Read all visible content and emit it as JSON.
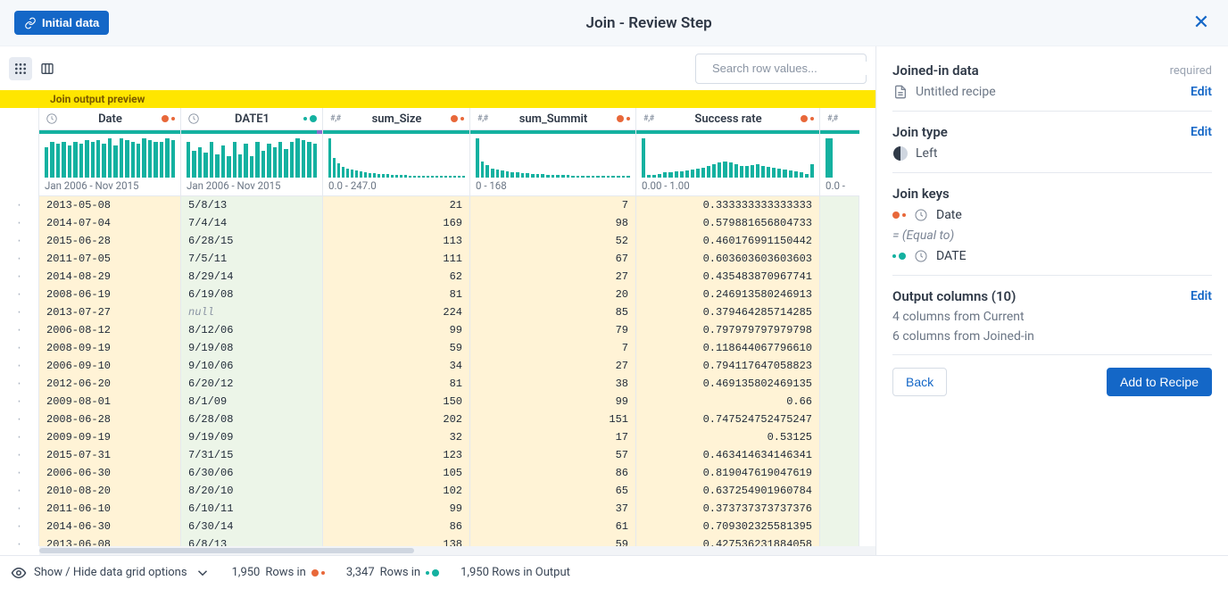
{
  "header": {
    "initial_data_label": "Initial data",
    "title": "Join - Review Step"
  },
  "toolbar": {
    "search_placeholder": "Search row values..."
  },
  "preview_band": "Join output preview",
  "columns": [
    {
      "name": "Date",
      "type": "date",
      "source": "left",
      "range": "Jan 2006 - Nov 2015",
      "chart": [
        34,
        40,
        38,
        40,
        36,
        40,
        38,
        42,
        40,
        42,
        38,
        44,
        36,
        44,
        42,
        40,
        38,
        44,
        42,
        40,
        40,
        44,
        42
      ]
    },
    {
      "name": "DATE1",
      "type": "date",
      "source": "right",
      "range": "Jan 2006 - Nov 2015",
      "chart": [
        40,
        30,
        34,
        28,
        40,
        26,
        36,
        24,
        40,
        26,
        38,
        24,
        40,
        30,
        38,
        34,
        40,
        32,
        40,
        44,
        42,
        40,
        38
      ]
    },
    {
      "name": "sum_Size",
      "type": "num",
      "source": "left",
      "range": "0.0 - 247.0",
      "chart": [
        44,
        22,
        16,
        12,
        10,
        9,
        8,
        7,
        6,
        5,
        5,
        4,
        4,
        4,
        3,
        3,
        3,
        3,
        2,
        2,
        2,
        2,
        2,
        2,
        2,
        2,
        2,
        2,
        2,
        2,
        2
      ]
    },
    {
      "name": "sum_Summit",
      "type": "num",
      "source": "left",
      "range": "0 - 168",
      "chart": [
        44,
        18,
        14,
        10,
        9,
        8,
        7,
        6,
        6,
        5,
        5,
        4,
        4,
        4,
        3,
        3,
        3,
        3,
        3,
        2,
        2,
        2,
        2,
        2,
        2,
        2,
        2,
        2,
        2,
        2,
        2
      ]
    },
    {
      "name": "Success rate",
      "type": "num",
      "source": "left",
      "range": "0.00 - 1.00",
      "chart": [
        40,
        3,
        3,
        4,
        5,
        5,
        6,
        6,
        7,
        8,
        9,
        10,
        12,
        14,
        15,
        16,
        15,
        14,
        12,
        12,
        13,
        14,
        12,
        11,
        10,
        9,
        8,
        7,
        6,
        5,
        4,
        14
      ]
    }
  ],
  "peek_col": {
    "type": "num",
    "range": "0.0 -"
  },
  "rows": [
    {
      "date": "2013-05-08",
      "date1": "5/8/13",
      "size": "21",
      "summit": "7",
      "rate": "0.333333333333333"
    },
    {
      "date": "2014-07-04",
      "date1": "7/4/14",
      "size": "169",
      "summit": "98",
      "rate": "0.579881656804733"
    },
    {
      "date": "2015-06-28",
      "date1": "6/28/15",
      "size": "113",
      "summit": "52",
      "rate": "0.460176991150442"
    },
    {
      "date": "2011-07-05",
      "date1": "7/5/11",
      "size": "111",
      "summit": "67",
      "rate": "0.603603603603603"
    },
    {
      "date": "2014-08-29",
      "date1": "8/29/14",
      "size": "62",
      "summit": "27",
      "rate": "0.435483870967741"
    },
    {
      "date": "2008-06-19",
      "date1": "6/19/08",
      "size": "81",
      "summit": "20",
      "rate": "0.246913580246913"
    },
    {
      "date": "2013-07-27",
      "date1_null": true,
      "size": "224",
      "summit": "85",
      "rate": "0.379464285714285"
    },
    {
      "date": "2006-08-12",
      "date1": "8/12/06",
      "size": "99",
      "summit": "79",
      "rate": "0.797979797979798"
    },
    {
      "date": "2008-09-19",
      "date1": "9/19/08",
      "size": "59",
      "summit": "7",
      "rate": "0.118644067796610"
    },
    {
      "date": "2006-09-10",
      "date1": "9/10/06",
      "size": "34",
      "summit": "27",
      "rate": "0.794117647058823"
    },
    {
      "date": "2012-06-20",
      "date1": "6/20/12",
      "size": "81",
      "summit": "38",
      "rate": "0.469135802469135"
    },
    {
      "date": "2009-08-01",
      "date1": "8/1/09",
      "size": "150",
      "summit": "99",
      "rate": "0.66"
    },
    {
      "date": "2008-06-28",
      "date1": "6/28/08",
      "size": "202",
      "summit": "151",
      "rate": "0.747524752475247"
    },
    {
      "date": "2009-09-19",
      "date1": "9/19/09",
      "size": "32",
      "summit": "17",
      "rate": "0.53125"
    },
    {
      "date": "2015-07-31",
      "date1": "7/31/15",
      "size": "123",
      "summit": "57",
      "rate": "0.463414634146341"
    },
    {
      "date": "2006-06-30",
      "date1": "6/30/06",
      "size": "105",
      "summit": "86",
      "rate": "0.819047619047619"
    },
    {
      "date": "2010-08-20",
      "date1": "8/20/10",
      "size": "102",
      "summit": "65",
      "rate": "0.637254901960784"
    },
    {
      "date": "2011-06-10",
      "date1": "6/10/11",
      "size": "99",
      "summit": "37",
      "rate": "0.373737373737376"
    },
    {
      "date": "2014-06-30",
      "date1": "6/30/14",
      "size": "86",
      "summit": "61",
      "rate": "0.709302325581395"
    },
    {
      "date": "2013-06-08",
      "date1": "6/8/13",
      "size": "138",
      "summit": "59",
      "rate": "0.427536231884058"
    }
  ],
  "footer": {
    "options_label": "Show / Hide data grid options",
    "rows_in_left_prefix": "1,950",
    "rows_in_left_suffix": "Rows in",
    "rows_in_right_prefix": "3,347",
    "rows_in_right_suffix": "Rows in",
    "rows_out": "1,950 Rows in Output"
  },
  "panel": {
    "joined_in": {
      "label": "Joined-in data",
      "required": "required",
      "recipe": "Untitled recipe",
      "edit": "Edit"
    },
    "join_type": {
      "label": "Join type",
      "value": "Left",
      "edit": "Edit"
    },
    "join_keys": {
      "label": "Join keys",
      "left_field": "Date",
      "op": "= (Equal to)",
      "right_field": "DATE"
    },
    "output_cols": {
      "label": "Output columns (10)",
      "from_current": "4 columns from Current",
      "from_joined": "6 columns from Joined-in",
      "edit": "Edit"
    },
    "back": "Back",
    "add": "Add to Recipe"
  }
}
